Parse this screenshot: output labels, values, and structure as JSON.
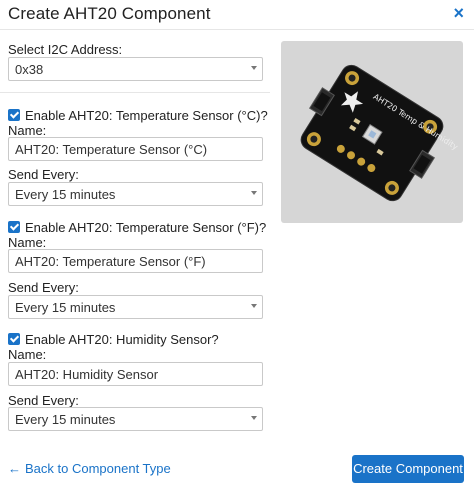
{
  "header": {
    "title": "Create AHT20 Component",
    "close_icon": "×"
  },
  "i2c": {
    "label": "Select I2C Address:",
    "value": "0x38"
  },
  "board_image": {
    "alt": "AHT20 Temp & Humidity breakout board",
    "silkscreen": "AHT20 Temp & Humidity"
  },
  "sensors": [
    {
      "enable_label": "Enable AHT20: Temperature Sensor (°C)?",
      "checked": true,
      "name_label": "Name:",
      "name_value": "AHT20: Temperature Sensor (°C)",
      "send_label": "Send Every:",
      "send_value": "Every 15 minutes"
    },
    {
      "enable_label": "Enable AHT20: Temperature Sensor (°F)?",
      "checked": true,
      "name_label": "Name:",
      "name_value": "AHT20: Temperature Sensor (°F)",
      "send_label": "Send Every:",
      "send_value": "Every 15 minutes"
    },
    {
      "enable_label": "Enable AHT20: Humidity Sensor?",
      "checked": true,
      "name_label": "Name:",
      "name_value": "AHT20: Humidity Sensor",
      "send_label": "Send Every:",
      "send_value": "Every 15 minutes"
    }
  ],
  "footer": {
    "back_label": "Back to Component Type",
    "create_label": "Create Component"
  },
  "colors": {
    "accent": "#1a73c8",
    "board": "#1c1c1c",
    "image_bg": "#d6d6d6"
  }
}
